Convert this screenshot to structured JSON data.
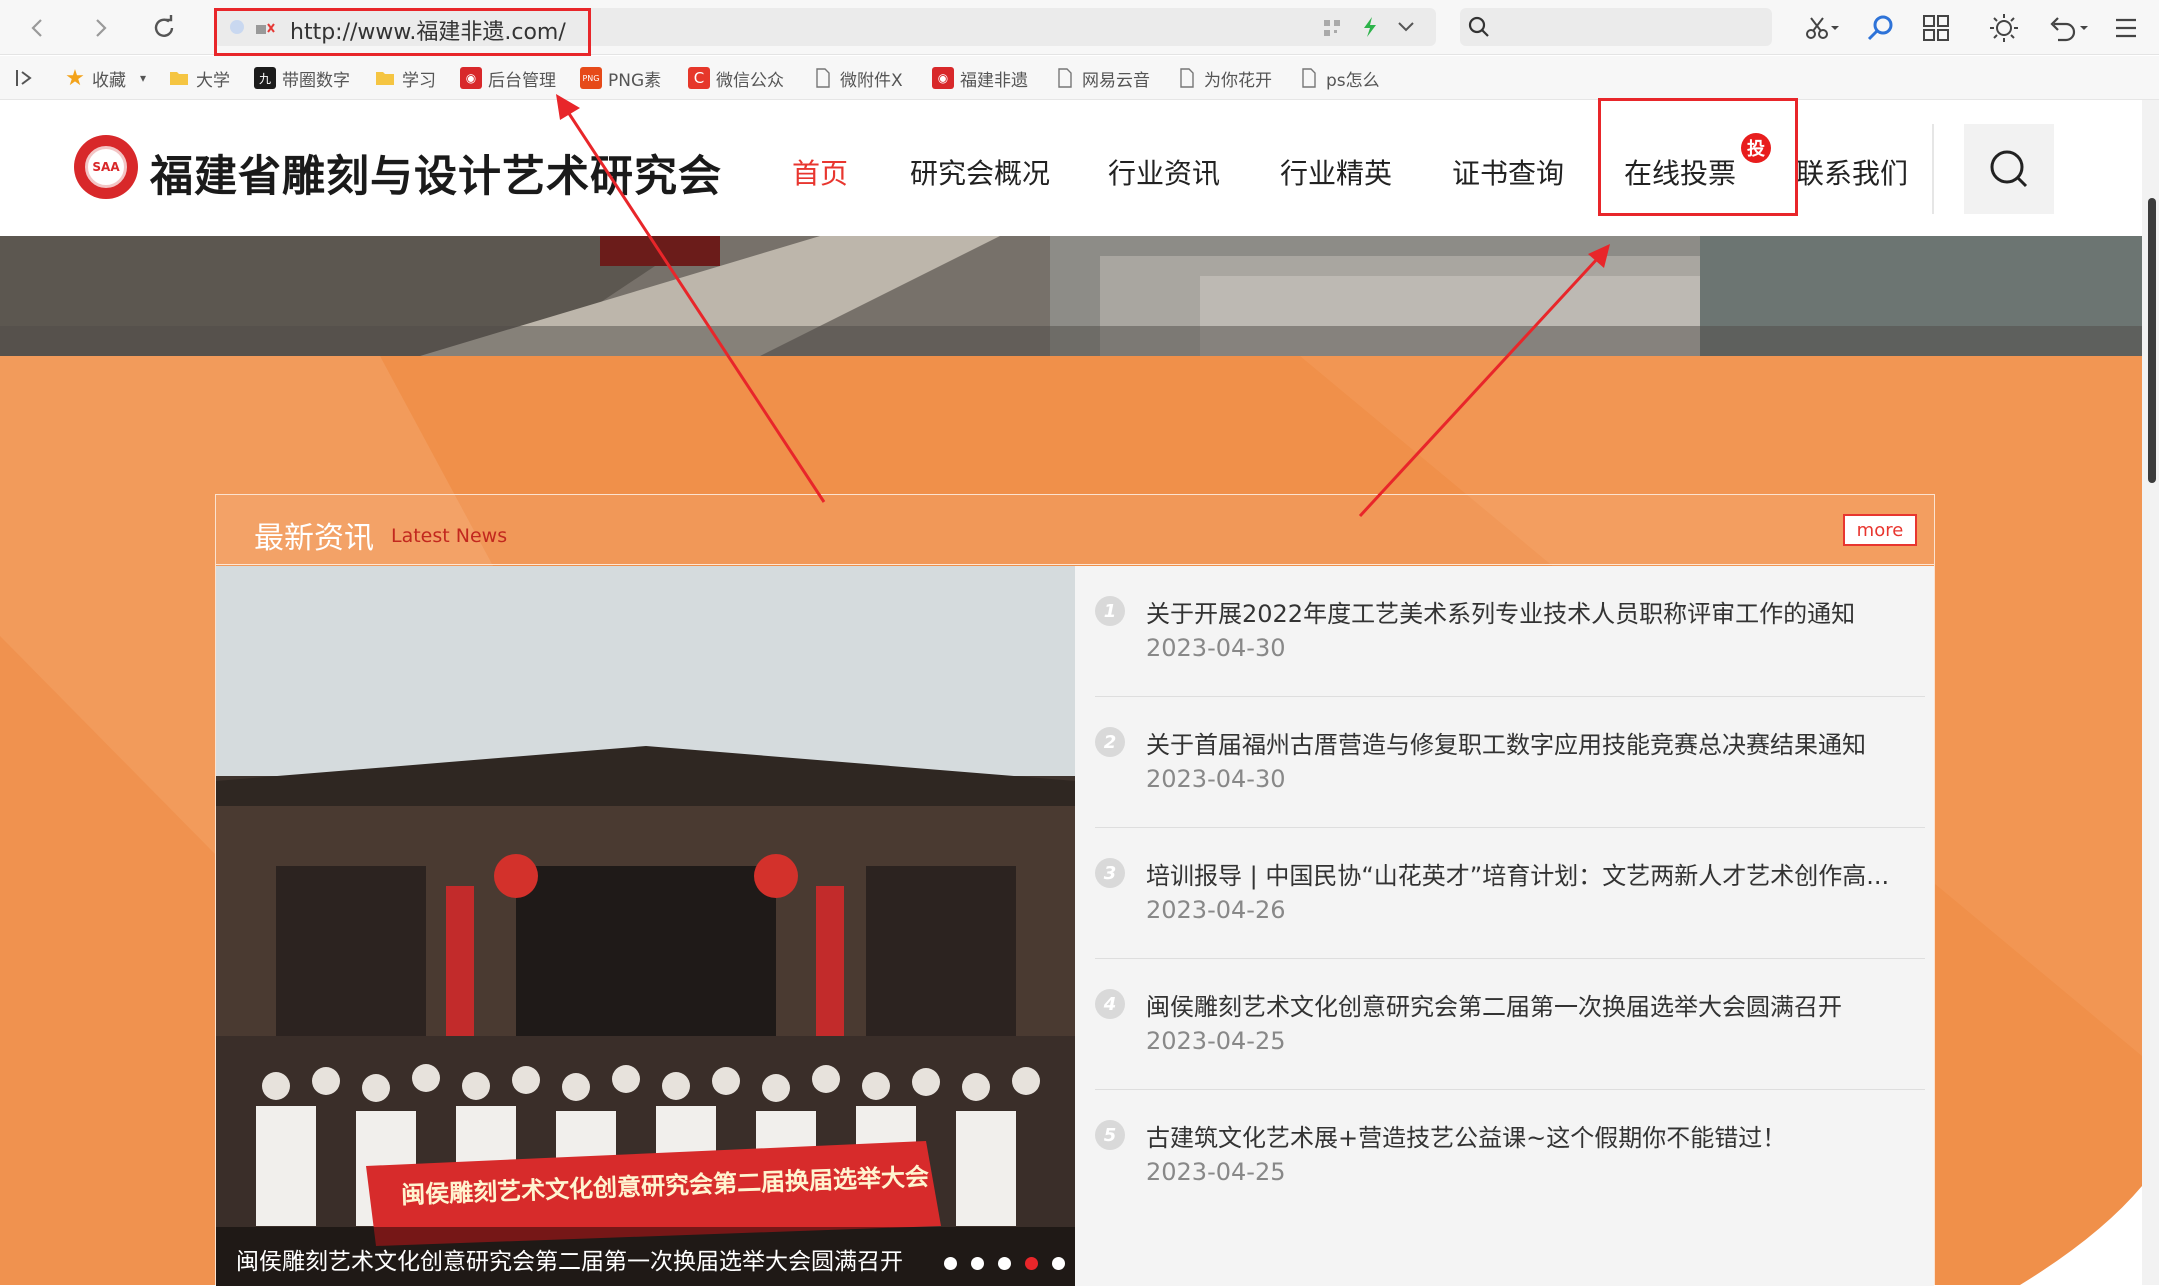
{
  "browser": {
    "url": "http://www.福建非遗.com/",
    "search_placeholder": ""
  },
  "bookmarks": [
    {
      "label": "收藏",
      "icon": "star-icon"
    },
    {
      "label": "大学",
      "icon": "folder-icon"
    },
    {
      "label": "带圈数字",
      "icon": "nine-icon"
    },
    {
      "label": "学习",
      "icon": "folder-icon"
    },
    {
      "label": "后台管理",
      "icon": "red-site-icon"
    },
    {
      "label": "PNG素",
      "icon": "png-icon"
    },
    {
      "label": "微信公众",
      "icon": "c-icon"
    },
    {
      "label": "微附件X",
      "icon": "page-icon"
    },
    {
      "label": "福建非遗",
      "icon": "red-site-icon"
    },
    {
      "label": "网易云音",
      "icon": "page-icon"
    },
    {
      "label": "为你花开",
      "icon": "page-icon"
    },
    {
      "label": "ps怎么",
      "icon": "page-icon"
    }
  ],
  "site": {
    "logo_text": "SAA",
    "title": "福建省雕刻与设计艺术研究会",
    "nav": [
      {
        "label": "首页",
        "active": true
      },
      {
        "label": "研究会概况"
      },
      {
        "label": "行业资讯"
      },
      {
        "label": "行业精英"
      },
      {
        "label": "证书查询"
      },
      {
        "label": "在线投票",
        "badge": "投"
      },
      {
        "label": "联系我们"
      }
    ]
  },
  "news": {
    "title": "最新资讯",
    "subtitle": "Latest News",
    "more_label": "more",
    "photo_caption": "闽侯雕刻艺术文化创意研究会第二届第一次换届选举大会圆满召开",
    "photo_banner_text": "闽侯雕刻艺术文化创意研究会第二届换届选举大会",
    "slide_count": 5,
    "active_slide": 4,
    "items": [
      {
        "num": "1",
        "title": "关于开展2022年度工艺美术系列专业技术人员职称评审工作的通知",
        "date": "2023-04-30"
      },
      {
        "num": "2",
        "title": "关于首届福州古厝营造与修复职工数字应用技能竞赛总决赛结果通知",
        "date": "2023-04-30"
      },
      {
        "num": "3",
        "title": "培训报导 | 中国民协“山花英才”培育计划：文艺两新人才艺术创作高...",
        "date": "2023-04-26"
      },
      {
        "num": "4",
        "title": "闽侯雕刻艺术文化创意研究会第二届第一次换届选举大会圆满召开",
        "date": "2023-04-25"
      },
      {
        "num": "5",
        "title": "古建筑文化艺术展+营造技艺公益课~这个假期你不能错过！",
        "date": "2023-04-25"
      }
    ]
  },
  "colors": {
    "accent_red": "#e8362f",
    "orange_bg": "#f0904a",
    "annotation_red": "#e8262a"
  }
}
